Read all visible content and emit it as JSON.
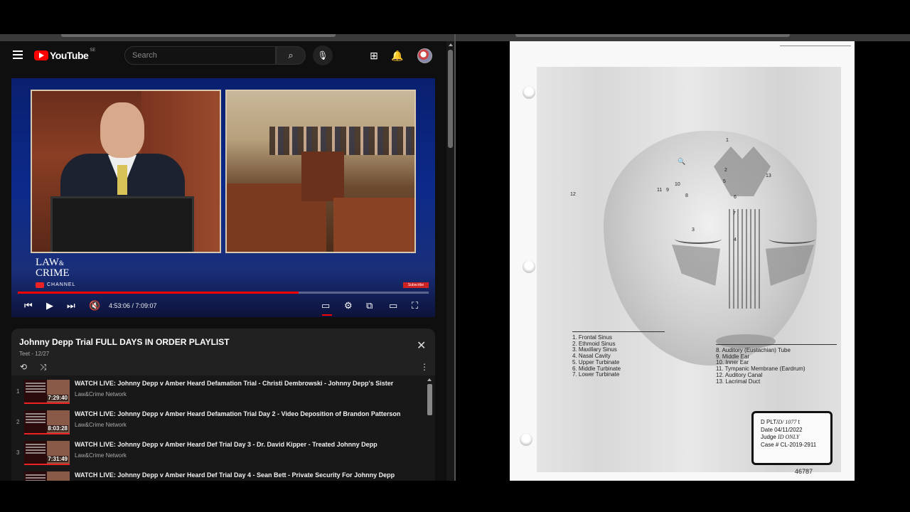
{
  "youtube": {
    "logo_text": "YouTube",
    "country_code": "SE",
    "search_placeholder": "Search",
    "icons": {
      "menu": "hamburger-icon",
      "search": "search-icon",
      "mic": "mic-icon",
      "create": "create-video-icon",
      "notifications": "bell-icon"
    }
  },
  "player": {
    "brand_line1": "LAW",
    "brand_amp": "&",
    "brand_line2": "CRIME",
    "brand_channel": "CHANNEL",
    "subscribe_badge": "Subscribe",
    "timecode": "4:53:06 / 7:09:07",
    "progress_fraction": 0.683,
    "accent_color": "#ff0000"
  },
  "playlist": {
    "title": "Johnny Depp Trial FULL DAYS IN ORDER PLAYLIST",
    "subtitle": "Teet - 12/27",
    "items": [
      {
        "index": "1",
        "title": "WATCH LIVE: Johnny Depp v Amber Heard Defamation Trial - Christi Dembrowski - Johnny Depp's Sister",
        "channel": "Law&Crime Network",
        "duration": "7:29:40"
      },
      {
        "index": "2",
        "title": "WATCH LIVE: Johnny Depp v Amber Heard Defamation Trial Day 2 - Video Deposition of Brandon Patterson",
        "channel": "Law&Crime Network",
        "duration": "8:03:28"
      },
      {
        "index": "3",
        "title": "WATCH LIVE: Johnny Depp v Amber Heard Def Trial Day 3 - Dr. David Kipper - Treated Johnny Depp",
        "channel": "Law&Crime Network",
        "duration": "7:31:49"
      },
      {
        "index": "",
        "title": "WATCH LIVE: Johnny Depp v Amber Heard Def Trial Day 4 - Sean Bett - Private Security For Johnny Depp",
        "channel": "",
        "duration": ""
      }
    ]
  },
  "document": {
    "legend_left": [
      "1. Frontal Sinus",
      "2. Ethmoid Sinus",
      "3. Maxillary Sinus",
      "4. Nasal Cavity",
      "5. Upper Turbinate",
      "6. Middle Turbinate",
      "7. Lower Turbinate"
    ],
    "legend_right": [
      "8. Auditory (Eustachian) Tube",
      "9. Middle Ear",
      "10. Inner Ear",
      "11. Tympanic Membrane (Eardrum)",
      "12. Auditory Canal",
      "13. Lacrimal Duct"
    ],
    "diagram_numbers": {
      "n1": "1",
      "n2": "2",
      "n3": "3",
      "n4": "4",
      "n5": "5",
      "n6": "6",
      "n7": "7",
      "n8": "8",
      "n9": "9",
      "n10": "10",
      "n11": "11",
      "n12": "12",
      "n13": "13"
    },
    "stamp": {
      "line1_prefix": "D",
      "line1_label": "PLT/",
      "line1_hand": "D/ 1077",
      "line1_suffix": "t",
      "date_label": "Date",
      "date_value": "04/11/2022",
      "judge_label": "Judge",
      "judge_hand": "ID ONLY",
      "case_label": "Case #",
      "case_value": "CL-2019-2911"
    },
    "doc_number": "46787"
  }
}
